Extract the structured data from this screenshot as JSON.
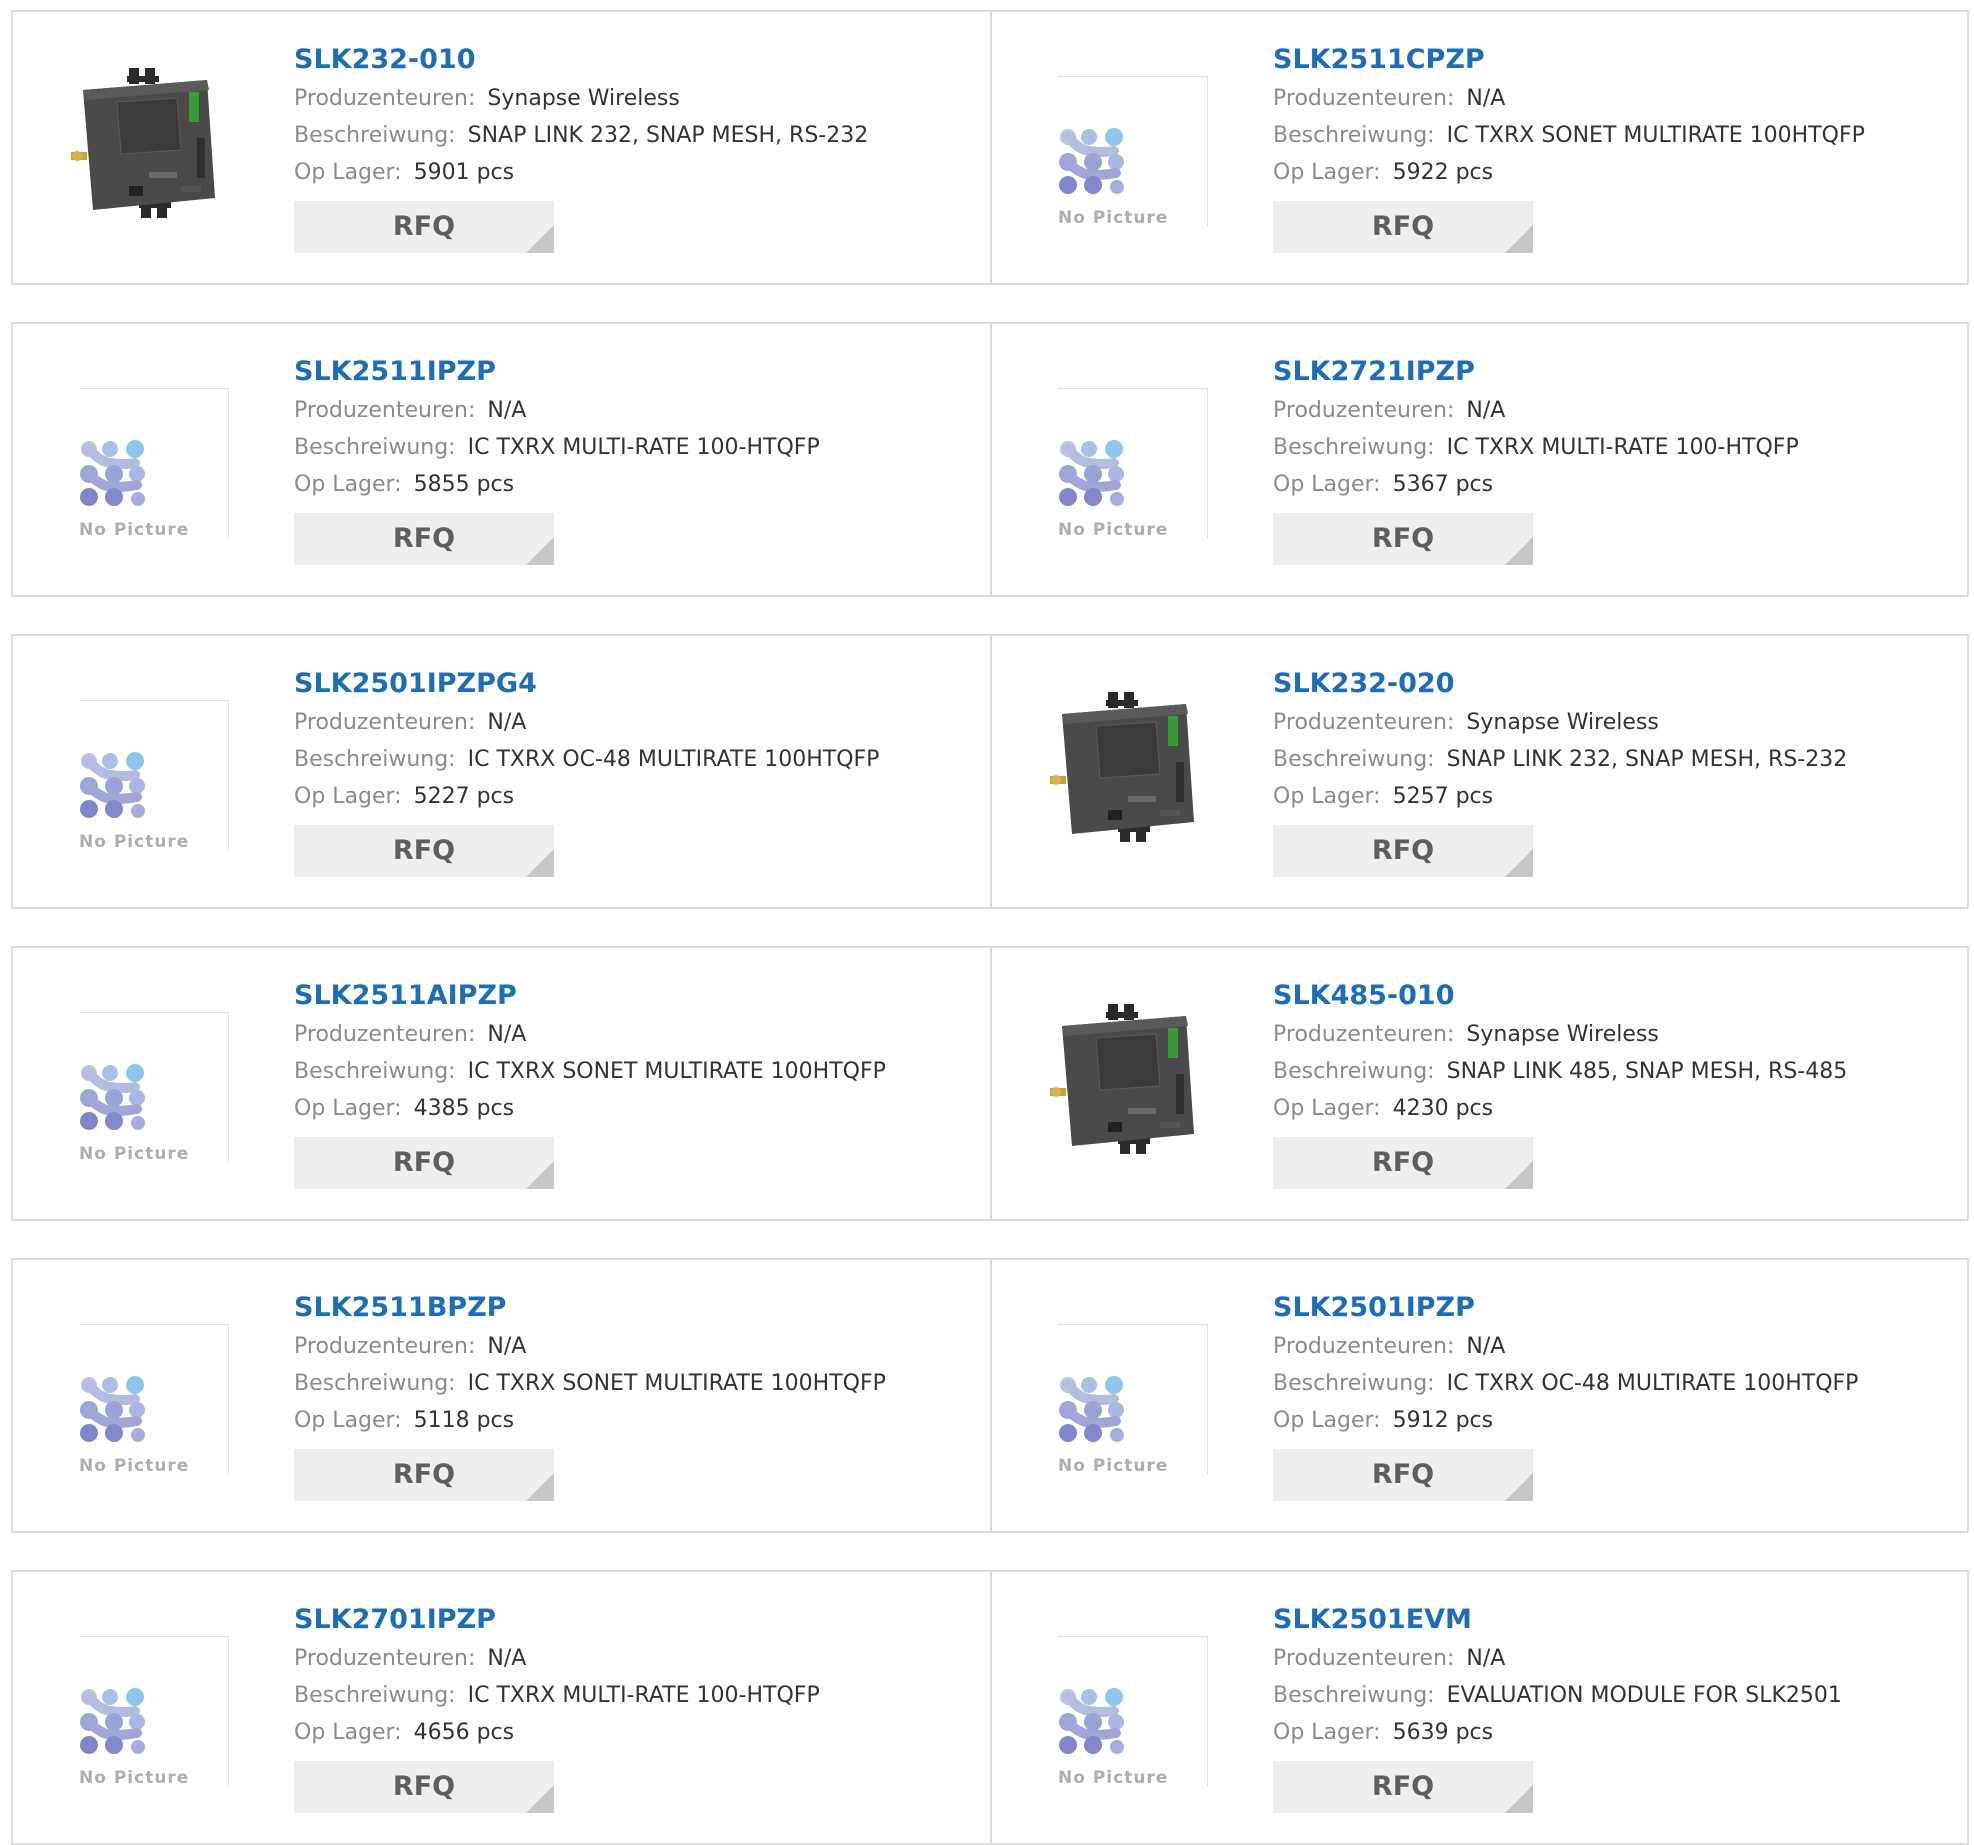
{
  "labels": {
    "manufacturer": "Produzenteuren:",
    "description": "Beschreiwung:",
    "stock": "Op Lager:",
    "rfq": "RFQ",
    "no_picture": "No Picture"
  },
  "colors": {
    "part_number": "#1f6db4",
    "label": "#8b8b8b",
    "value": "#333333",
    "button_bg": "#eeeeee",
    "border": "#dddddd"
  },
  "rows": [
    [
      {
        "part": "SLK232-010",
        "manufacturer": "Synapse Wireless",
        "description": "SNAP LINK 232, SNAP MESH, RS-232",
        "stock": "5901 pcs",
        "image": "device-photo-icon"
      },
      {
        "part": "SLK2511CPZP",
        "manufacturer": "N/A",
        "description": "IC TXRX SONET MULTIRATE 100HTQFP",
        "stock": "5922 pcs",
        "image": "no-picture-icon"
      }
    ],
    [
      {
        "part": "SLK2511IPZP",
        "manufacturer": "N/A",
        "description": "IC TXRX MULTI-RATE 100-HTQFP",
        "stock": "5855 pcs",
        "image": "no-picture-icon"
      },
      {
        "part": "SLK2721IPZP",
        "manufacturer": "N/A",
        "description": "IC TXRX MULTI-RATE 100-HTQFP",
        "stock": "5367 pcs",
        "image": "no-picture-icon"
      }
    ],
    [
      {
        "part": "SLK2501IPZPG4",
        "manufacturer": "N/A",
        "description": "IC TXRX OC-48 MULTIRATE 100HTQFP",
        "stock": "5227 pcs",
        "image": "no-picture-icon"
      },
      {
        "part": "SLK232-020",
        "manufacturer": "Synapse Wireless",
        "description": "SNAP LINK 232, SNAP MESH, RS-232",
        "stock": "5257 pcs",
        "image": "device-photo-icon"
      }
    ],
    [
      {
        "part": "SLK2511AIPZP",
        "manufacturer": "N/A",
        "description": "IC TXRX SONET MULTIRATE 100HTQFP",
        "stock": "4385 pcs",
        "image": "no-picture-icon"
      },
      {
        "part": "SLK485-010",
        "manufacturer": "Synapse Wireless",
        "description": "SNAP LINK 485, SNAP MESH, RS-485",
        "stock": "4230 pcs",
        "image": "device-photo-icon"
      }
    ],
    [
      {
        "part": "SLK2511BPZP",
        "manufacturer": "N/A",
        "description": "IC TXRX SONET MULTIRATE 100HTQFP",
        "stock": "5118 pcs",
        "image": "no-picture-icon"
      },
      {
        "part": "SLK2501IPZP",
        "manufacturer": "N/A",
        "description": "IC TXRX OC-48 MULTIRATE 100HTQFP",
        "stock": "5912 pcs",
        "image": "no-picture-icon"
      }
    ],
    [
      {
        "part": "SLK2701IPZP",
        "manufacturer": "N/A",
        "description": "IC TXRX MULTI-RATE 100-HTQFP",
        "stock": "4656 pcs",
        "image": "no-picture-icon"
      },
      {
        "part": "SLK2501EVM",
        "manufacturer": "N/A",
        "description": "EVALUATION MODULE FOR SLK2501",
        "stock": "5639 pcs",
        "image": "no-picture-icon"
      }
    ]
  ]
}
